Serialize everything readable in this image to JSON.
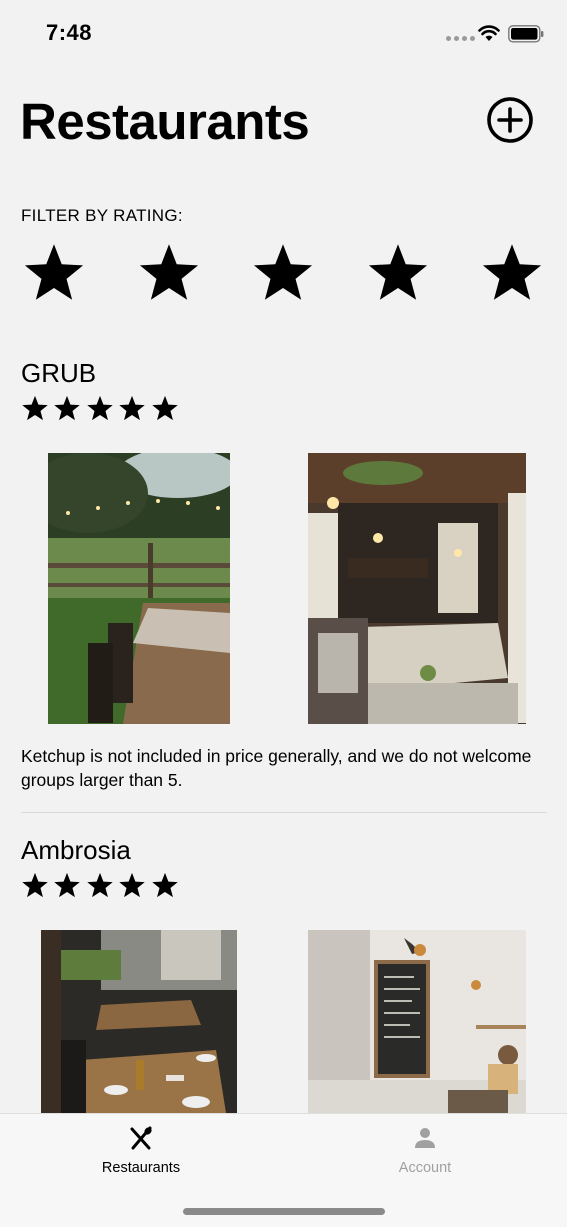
{
  "status_bar": {
    "time": "7:48",
    "icons": [
      "cellular-dots-icon",
      "wifi-icon",
      "battery-icon"
    ]
  },
  "header": {
    "title": "Restaurants",
    "add_icon": "plus-circle-icon"
  },
  "filter": {
    "label": "FILTER BY RATING:",
    "stars": 5,
    "star_icon": "star-icon"
  },
  "restaurants": [
    {
      "name": "GRUB",
      "rating": 5,
      "description": "Ketchup is not included in price generally, and we do not welcome groups larger than 5."
    },
    {
      "name": "Ambrosia",
      "rating": 5
    }
  ],
  "tab_bar": {
    "tabs": [
      {
        "label": "Restaurants",
        "icon": "fork-knife-icon",
        "active": true
      },
      {
        "label": "Account",
        "icon": "person-icon",
        "active": false
      }
    ]
  },
  "colors": {
    "background": "#f2f2f2",
    "text": "#000000",
    "tab_inactive": "#a0a0a0",
    "divider": "#d8d8d8"
  }
}
